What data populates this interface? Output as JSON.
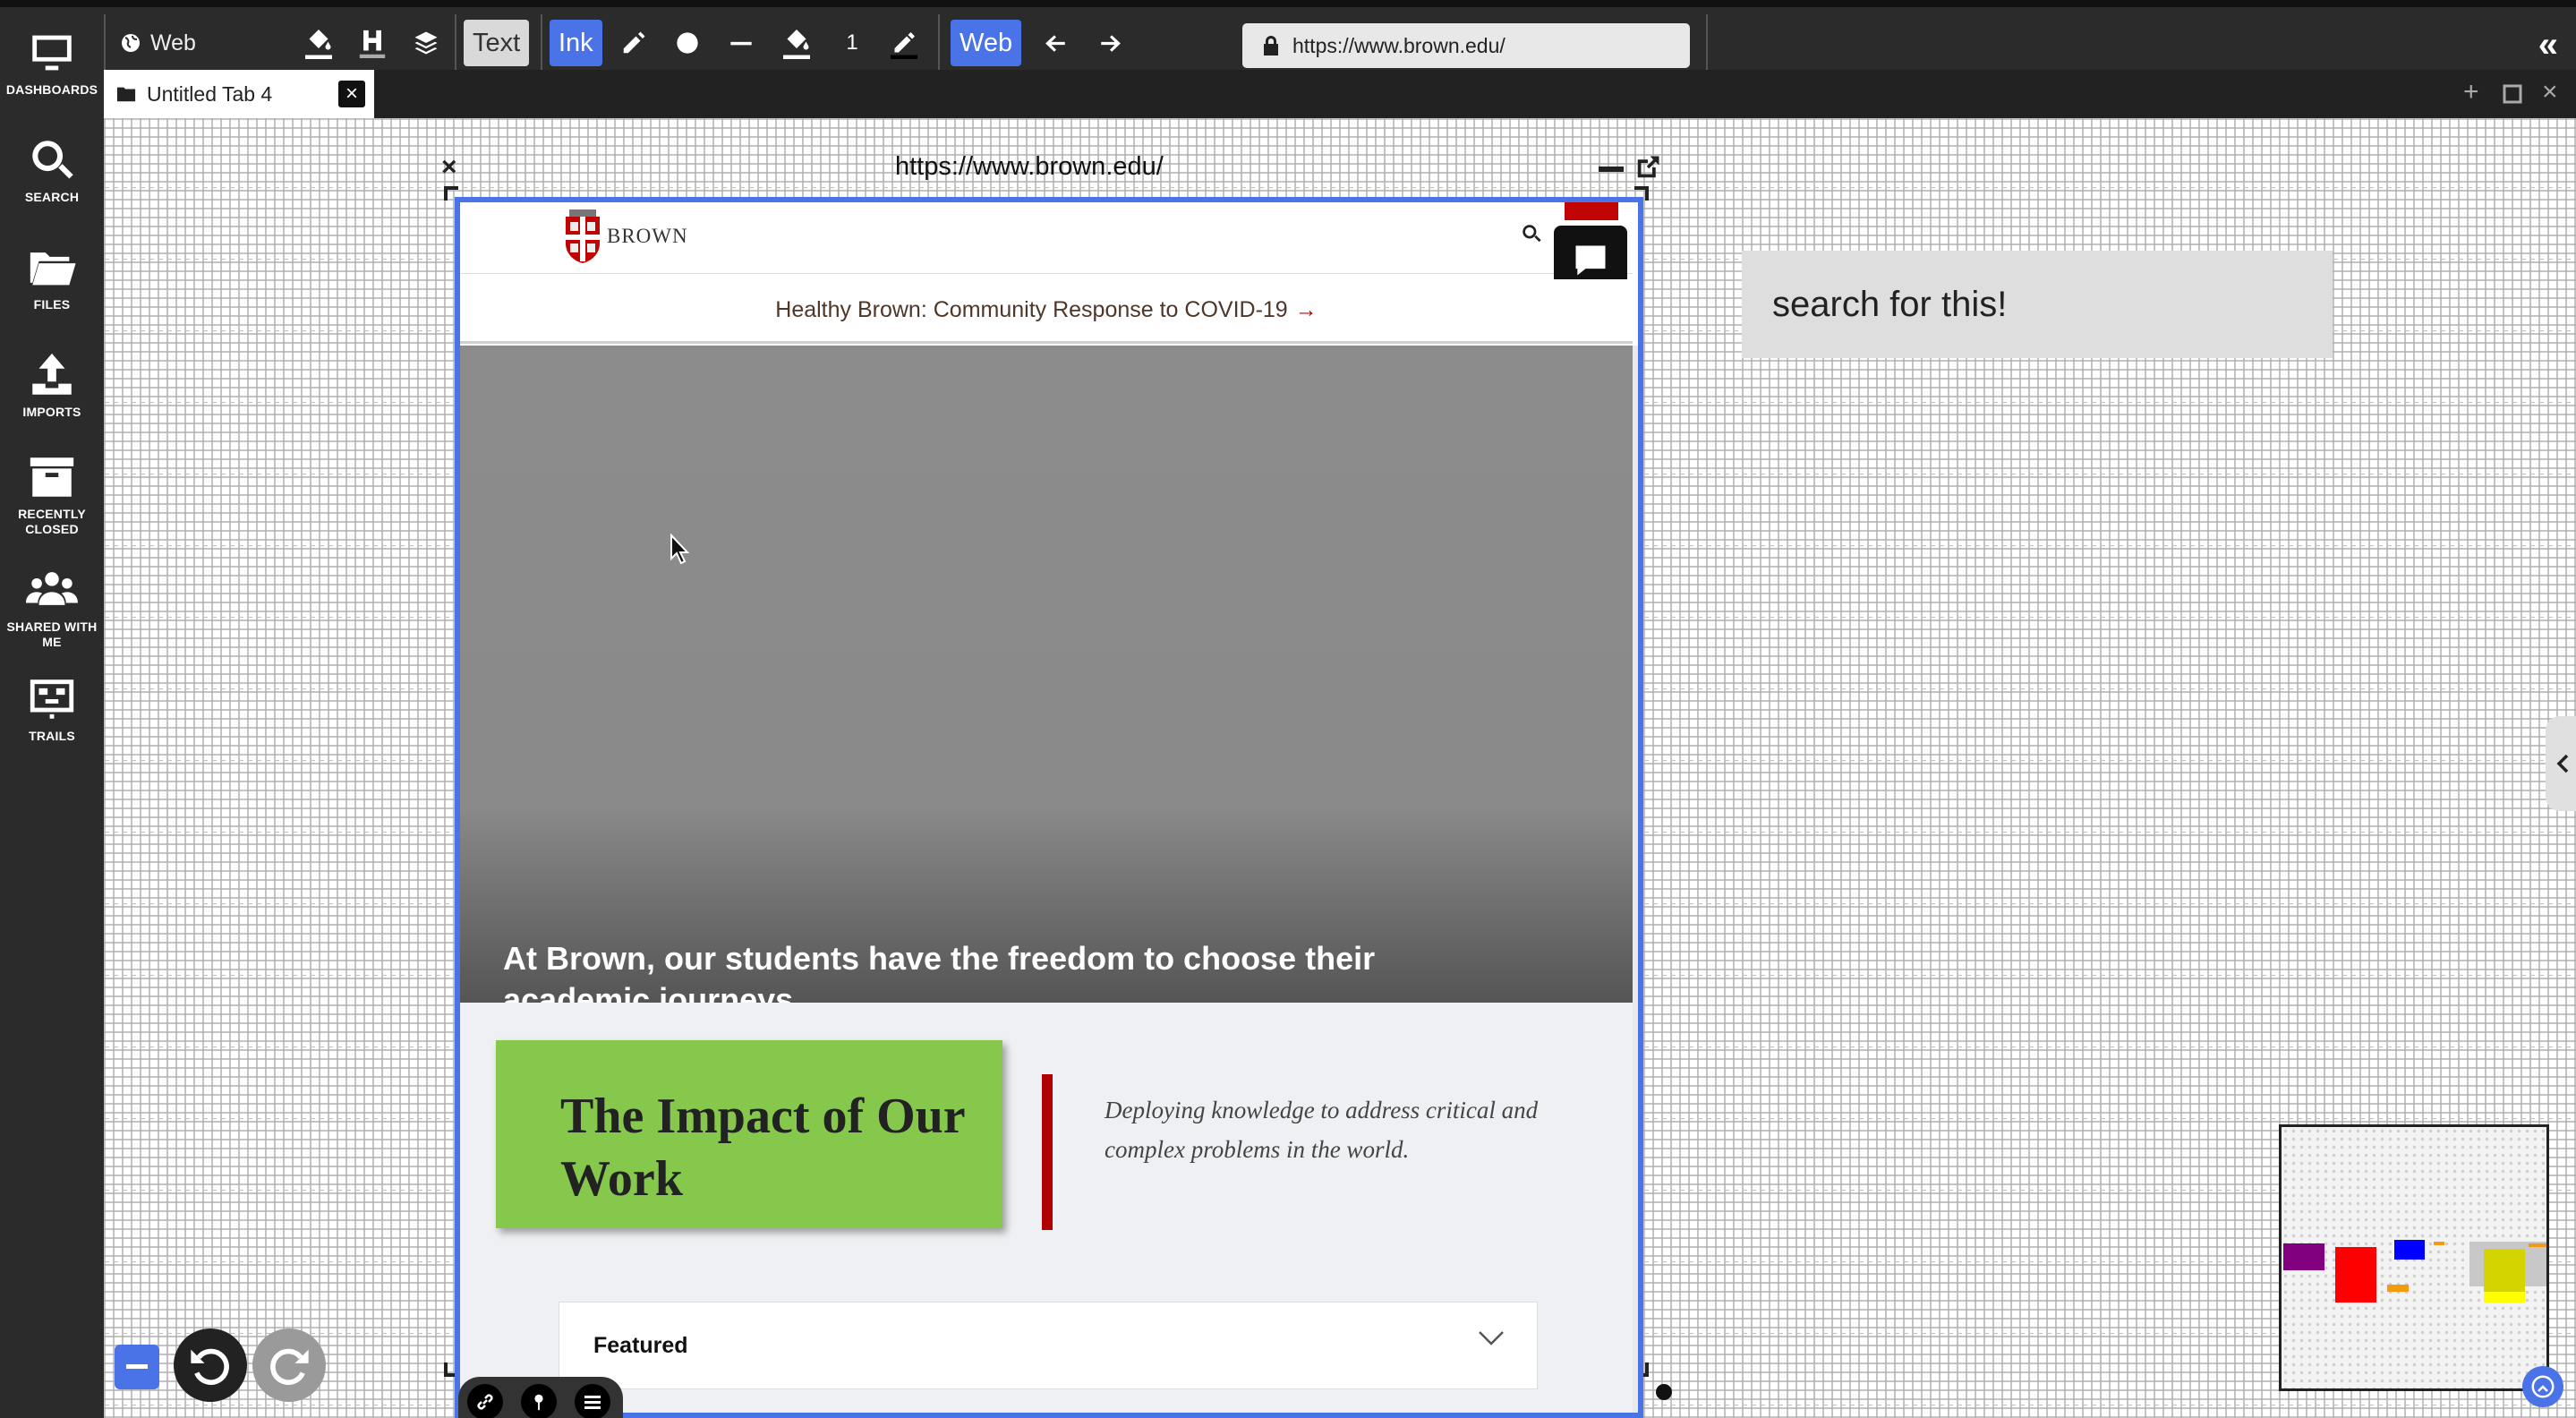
{
  "sidebar": {
    "items": [
      {
        "label": "DASHBOARDS",
        "icon": "monitor-icon"
      },
      {
        "label": "SEARCH",
        "icon": "search-icon"
      },
      {
        "label": "FILES",
        "icon": "folder-icon"
      },
      {
        "label": "IMPORTS",
        "icon": "upload-icon"
      },
      {
        "label": "RECENTLY CLOSED",
        "icon": "archive-icon"
      },
      {
        "label": "SHARED WITH ME",
        "icon": "users-icon"
      },
      {
        "label": "TRAILS",
        "icon": "trails-icon"
      }
    ]
  },
  "toolbar": {
    "web_mode_label": "Web",
    "text_btn": "Text",
    "ink_btn": "Ink",
    "stroke_width": "1",
    "web_btn": "Web",
    "url": "https://www.brown.edu/",
    "accent": "#4a73e8"
  },
  "tabbar": {
    "tab_label": "Untitled Tab 4"
  },
  "document": {
    "title": "https://www.brown.edu/",
    "site": {
      "brand": "BROWN",
      "covid_banner": "Healthy Brown: Community Response to COVID-19",
      "covid_arrow": "→",
      "hero_text": "At Brown, our students have the freedom to choose their academic journeys.",
      "impact_title": "The Impact of Our Work",
      "impact_desc": "Deploying knowledge to address critical and complex problems in the world.",
      "featured_label": "Featured",
      "brand_red": "#c00404",
      "impact_green": "#86c84c"
    }
  },
  "search_note": {
    "text": "search for this!"
  }
}
